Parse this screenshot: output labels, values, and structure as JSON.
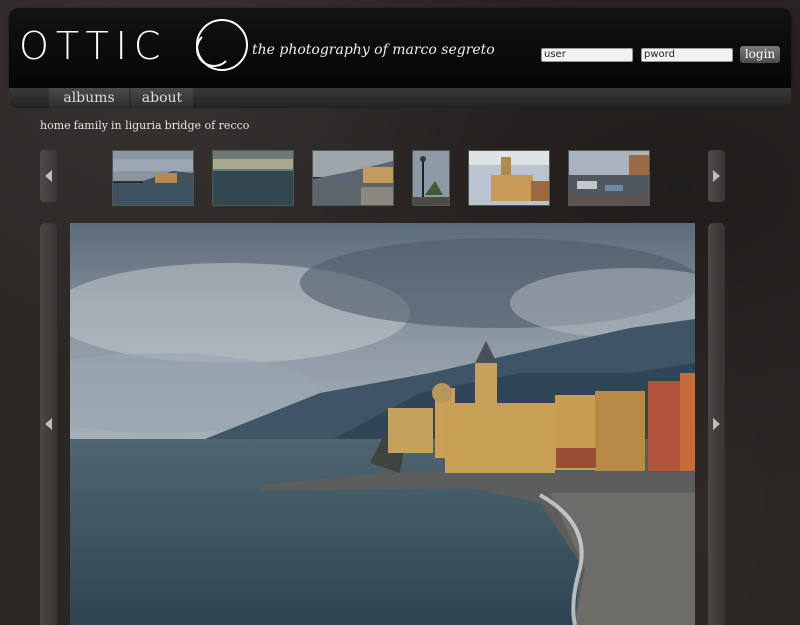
{
  "brand": {
    "logo": "OTTIC",
    "tagline": "the photography of marco segreto"
  },
  "login": {
    "user_placeholder": "user",
    "pass_placeholder": "pword",
    "button": "login"
  },
  "nav": [
    {
      "label": "albums"
    },
    {
      "label": "about"
    }
  ],
  "breadcrumb": [
    "home",
    "family",
    "in liguria",
    "bridge of recco"
  ],
  "thumbnails": [
    {
      "name": "camogli-harbor-view"
    },
    {
      "name": "stormy-sea-view"
    },
    {
      "name": "coastal-town-view"
    },
    {
      "name": "lamp-post-palm"
    },
    {
      "name": "yellow-church"
    },
    {
      "name": "harbor-boats"
    }
  ],
  "icons": {
    "prev": "chevron-left-icon",
    "next": "chevron-right-icon"
  }
}
